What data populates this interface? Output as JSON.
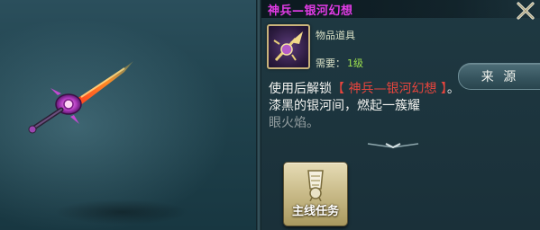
{
  "item": {
    "title": "神兵—银河幻想",
    "type": "物品道具",
    "requirement_label": "需要：",
    "requirement_value": "1级"
  },
  "description": {
    "prefix": "使用后解锁",
    "highlight": "【 神兵—银河幻想 】",
    "suffix": "。",
    "line2": "漆黑的银河间，燃起一簇耀",
    "line3": "眼火焰。"
  },
  "buttons": {
    "source": "来 源",
    "quest": "主线任务"
  },
  "icons": {
    "close": "close-icon",
    "item": "weapon-item-icon",
    "quest": "quest-scroll-icon",
    "scroll": "scroll-down-indicator"
  },
  "colors": {
    "title": "#e23be6",
    "highlight": "#e8453d",
    "requirement": "#9fe34f"
  }
}
